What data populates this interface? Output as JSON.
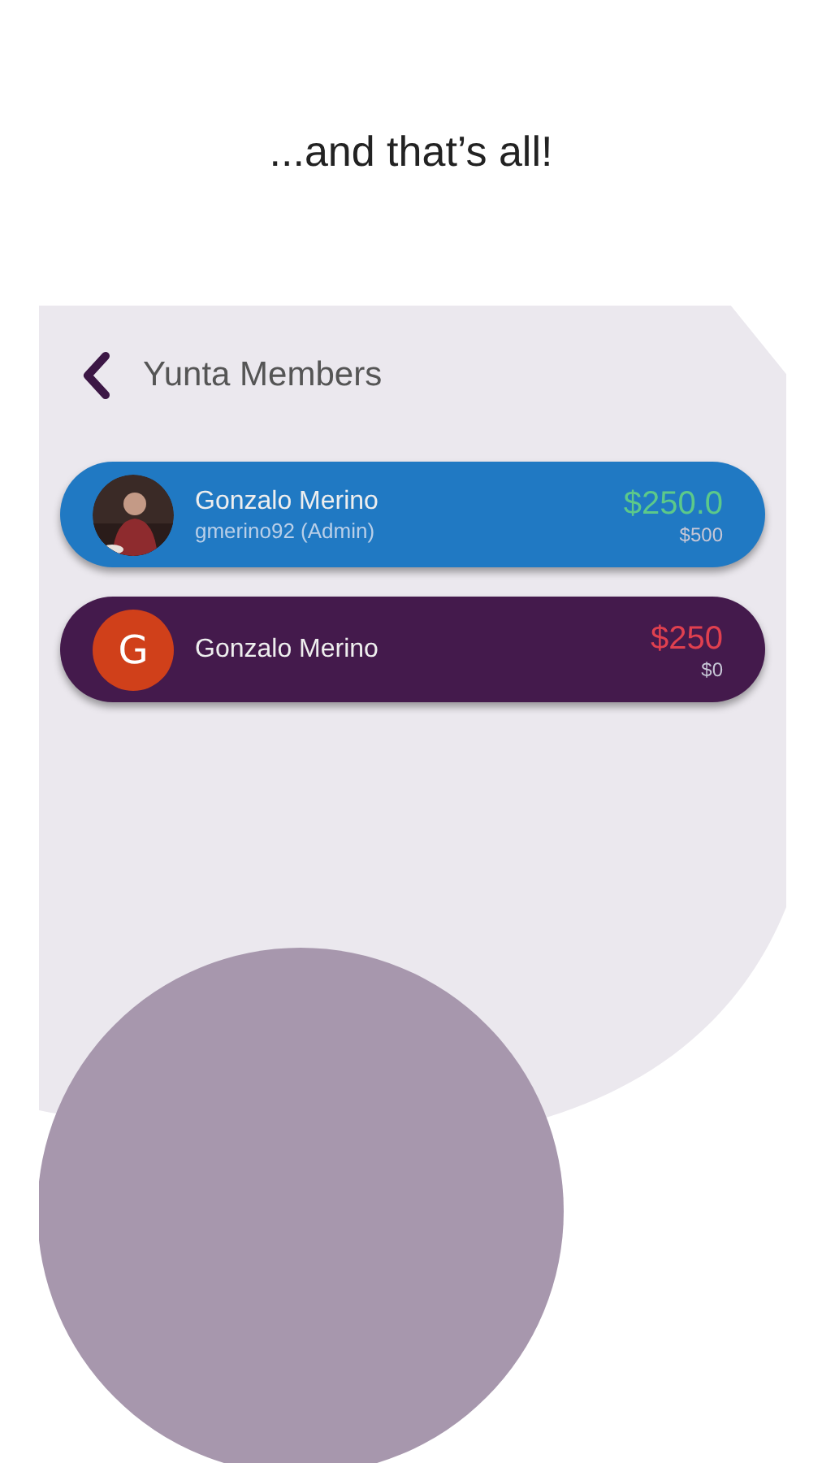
{
  "headline": "...and that’s all!",
  "screen": {
    "title": "Yunta Members"
  },
  "members": [
    {
      "name": "Gonzalo Merino",
      "subtitle": "gmerino92 (Admin)",
      "amount": "$250.0",
      "negative": false,
      "total": "$500",
      "color": "#2079c3"
    },
    {
      "kind": "initial",
      "initial": "G",
      "name": "Gonzalo Merino",
      "amount": "$250",
      "negative": true,
      "total": "$0",
      "color": "#441a4c"
    }
  ]
}
